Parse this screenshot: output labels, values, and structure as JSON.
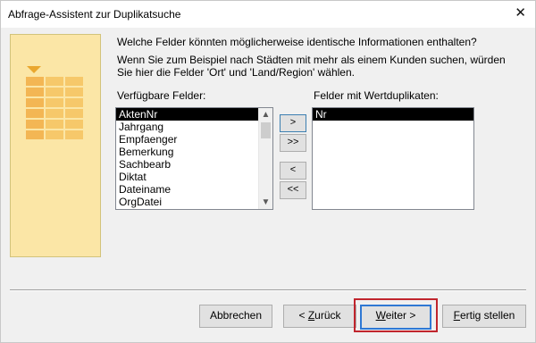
{
  "window": {
    "title": "Abfrage-Assistent zur Duplikatsuche",
    "close_glyph": "✕"
  },
  "question": {
    "heading": "Welche Felder könnten möglicherweise identische Informationen enthalten?",
    "hint": "Wenn Sie zum Beispiel nach Städten mit mehr als einem Kunden suchen, würden Sie hier die Felder 'Ort' und 'Land/Region' wählen."
  },
  "available_fields": {
    "label": "Verfügbare Felder:",
    "items": [
      "AktenNr",
      "Jahrgang",
      "Empfaenger",
      "Bemerkung",
      "Sachbearb",
      "Diktat",
      "Dateiname",
      "OrgDatei"
    ],
    "selected_index": 0
  },
  "dup_fields": {
    "label": "Felder mit Wertduplikaten:",
    "items": [
      "Nr"
    ],
    "selected_index": 0
  },
  "move_buttons": {
    "add_one": ">",
    "add_all": ">>",
    "remove_one": "<",
    "remove_all": "<<"
  },
  "footer": {
    "cancel": "Abbrechen",
    "back_prefix": "< ",
    "back_accel": "Z",
    "back_rest": "urück",
    "next_accel": "W",
    "next_rest": "eiter >",
    "finish_accel": "F",
    "finish_rest": "ertig stellen"
  },
  "colors": {
    "highlight": "#c0252d",
    "illustration": "#fbe6a6",
    "selection": "#000000"
  }
}
